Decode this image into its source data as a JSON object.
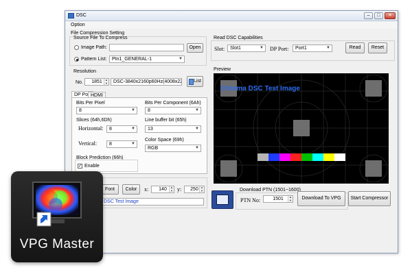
{
  "window": {
    "title": "DSC",
    "minimize_glyph": "–",
    "maximize_glyph": "□",
    "close_glyph": "✕"
  },
  "menu": {
    "option": "Option"
  },
  "compression": {
    "group_title": "File Compression Setting",
    "source_title": "Source File To Compress",
    "image_path_label": "Image Path:",
    "image_path_value": "",
    "open_button": "Open",
    "pattern_list_label": "Pattern List:",
    "pattern_list_value": "Ptn1_GENERAL-1"
  },
  "resolution": {
    "title": "Resolution",
    "no_label": "No.",
    "no_value": "1851",
    "value": "DSC-3840x2160p60Hz(4008x2265)",
    "list_button": "List"
  },
  "tabs": {
    "dp_port": "DP Port",
    "hdmi": "HDMI"
  },
  "dp": {
    "bpp_label": "Bits Per Pixel",
    "bpp_value": "8",
    "bpc_label": "Bits Per Component (6Ah)",
    "bpc_value": "8",
    "slices_label": "Slices (64h,6Dh)",
    "horizontal_label": "Horizontal:",
    "horizontal_value": "8",
    "vertical_label": "Vertical:",
    "vertical_value": "8",
    "line_buffer_label": "Line buffer bit (65h)",
    "line_buffer_value": "13",
    "color_space_label": "Color Space (69h)",
    "color_space_value": "RGB",
    "block_pred_label": "Block Prediction (66h)",
    "enable_label": "Enable",
    "enable_checked": true
  },
  "overlay": {
    "font_button": "Font",
    "color_button": "Color",
    "x_label": "x:",
    "x_value": "140",
    "y_label": "y:",
    "y_value": "250",
    "text_value": "DSC Test Image"
  },
  "read_dsc": {
    "title": "Read DSC Capabilities",
    "slot_label": "Slot:",
    "slot_value": "Slot1",
    "dp_port_label": "DP Port:",
    "dp_port_value": "Port1",
    "read_button": "Read",
    "reset_button": "Reset"
  },
  "preview": {
    "title": "Preview",
    "caption": "Chroma DSC Test Image",
    "caption_color": "#2e6df0",
    "bars": [
      "#b4b4b4",
      "#1e3cff",
      "#ff00ff",
      "#ff2020",
      "#00c000",
      "#00ffff",
      "#ffff00",
      "#ffffff"
    ]
  },
  "download": {
    "title": "Download PTN (1501~1600)",
    "ptn_no_label": "PTN No:",
    "ptn_no_value": "1501",
    "download_button": "Download To VPG",
    "start_button": "Start Compressor"
  },
  "desktop_icon": {
    "label": "VPG Master",
    "icon": "vpg-master-icon"
  }
}
